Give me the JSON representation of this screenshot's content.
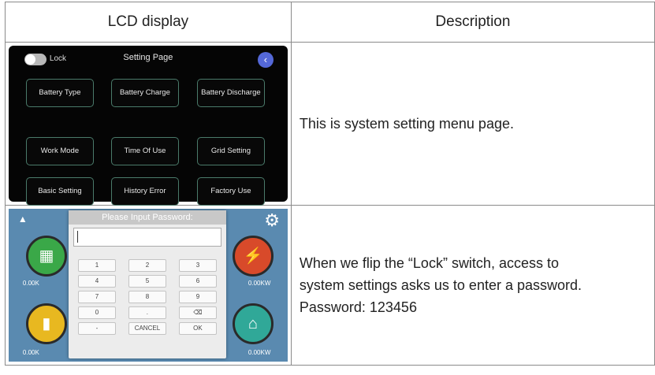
{
  "table": {
    "header": {
      "col1": "LCD display",
      "col2": "Description"
    },
    "rows": [
      {
        "description": "This is system setting menu page."
      },
      {
        "description_lines": [
          "When we flip the “Lock” switch, access to",
          "system settings asks us to enter a password.",
          "Password: 123456"
        ]
      }
    ]
  },
  "lcd1": {
    "lock_label": "Lock",
    "title": "Setting Page",
    "back_icon": "chevron-left-icon",
    "buttons": [
      "Battery Type",
      "Battery Charge",
      "Battery Discharge",
      "Work Mode",
      "Time Of Use",
      "Grid Setting",
      "Basic Setting",
      "History Error",
      "Factory Use"
    ]
  },
  "lcd2": {
    "warning_icon": "warning-icon",
    "settings_icon": "gear-icon",
    "dialog_title": "Please Input Password:",
    "keys": [
      "1",
      "2",
      "3",
      "4",
      "5",
      "6",
      "7",
      "8",
      "9",
      "0",
      ".",
      "⌫",
      "-",
      "CANCEL",
      "OK"
    ],
    "power_readings": {
      "solar": "0.00K",
      "grid": "0.00KW",
      "battery": "0.00K",
      "home": "0.00KW"
    }
  },
  "colors": {
    "back_button": "#5468d8",
    "lcd_bg": "#050505",
    "dashboard_bg": "#5a8ab0"
  }
}
